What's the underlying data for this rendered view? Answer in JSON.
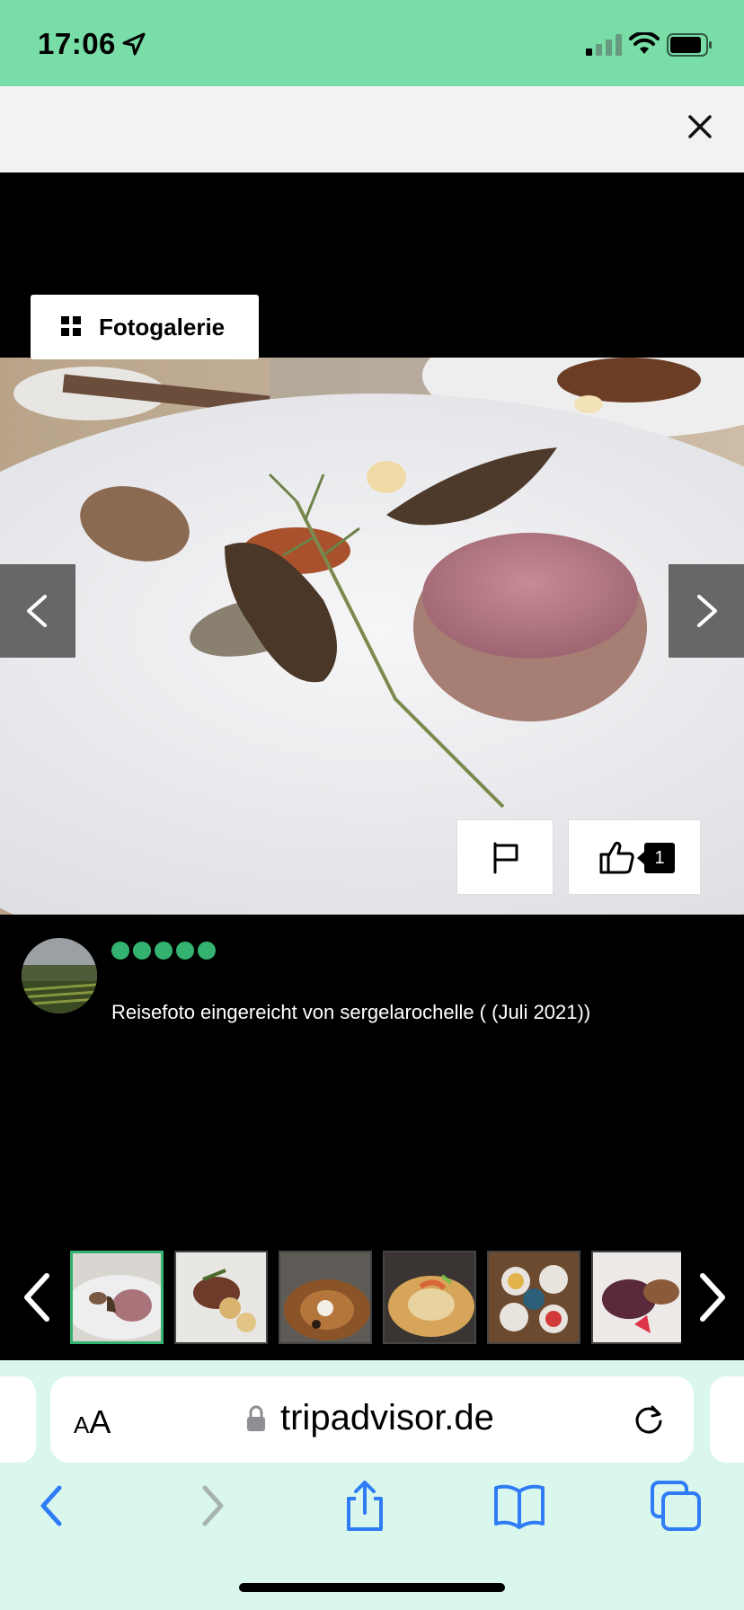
{
  "status_bar": {
    "time": "17:06",
    "icons": [
      "location-arrow-icon",
      "cellular-signal-icon",
      "wifi-icon",
      "battery-icon"
    ]
  },
  "top_bar": {
    "close_icon": "close-icon"
  },
  "gallery_button": {
    "label": "Fotogalerie",
    "icon": "grid-icon"
  },
  "photo": {
    "prev_icon": "chevron-left-icon",
    "next_icon": "chevron-right-icon",
    "flag_icon": "flag-icon",
    "like_icon": "thumbs-up-icon",
    "like_count": "1"
  },
  "review": {
    "rating_bubbles": 5,
    "caption": "Reisefoto eingereicht von sergelarochelle ( (Juli 2021))"
  },
  "thumbnails": {
    "count_visible": 6,
    "active_index": 0
  },
  "browser": {
    "aa_label_small": "A",
    "aa_label_large": "A",
    "url": "tripadvisor.de",
    "toolbar_icons": [
      "back-icon",
      "forward-icon",
      "share-icon",
      "bookmarks-icon",
      "tabs-icon"
    ]
  },
  "colors": {
    "status_bar": "#78dda7",
    "rating_green": "#34b26f",
    "browser_bg": "#d9f7ec",
    "accent_blue": "#2f7cf6"
  }
}
